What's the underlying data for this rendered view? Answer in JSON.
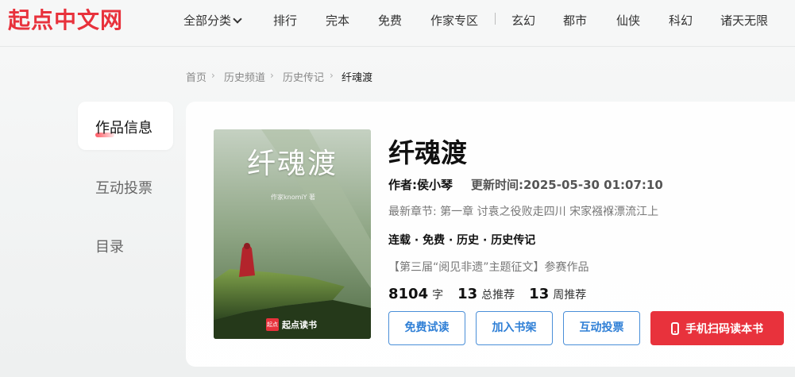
{
  "logo": "起点中文网",
  "nav": {
    "all_categories": "全部分类",
    "items": [
      "排行",
      "完本",
      "免费",
      "作家专区"
    ],
    "genres": [
      "玄幻",
      "都市",
      "仙侠",
      "科幻",
      "诸天无限"
    ]
  },
  "breadcrumb": [
    "首页",
    "历史频道",
    "历史传记",
    "纤魂渡"
  ],
  "side_tabs": [
    "作品信息",
    "互动投票",
    "目录"
  ],
  "cover": {
    "title": "纤魂渡",
    "author_line": "作家knomiY 著",
    "badge_icon": "起点",
    "badge_text": "起点读书"
  },
  "book": {
    "title": "纤魂渡",
    "author_label": "作者:",
    "author": "侯小琴",
    "update_label": "更新时间:",
    "update_time": "2025-05-30 01:07:10",
    "latest_label": "最新章节:",
    "latest_chapter": "第一章 讨袁之役败走四川 宋家襁褓漂流江上",
    "tags": [
      "连载",
      "免费",
      "历史",
      "历史传记"
    ],
    "event": "【第三届“阅见非遗”主题征文】参赛作品",
    "stats": [
      {
        "value": "8104",
        "unit": "字"
      },
      {
        "value": "13",
        "unit": "总推荐"
      },
      {
        "value": "13",
        "unit": "周推荐"
      }
    ]
  },
  "buttons": {
    "free_read": "免费试读",
    "add_shelf": "加入书架",
    "vote": "互动投票",
    "scan": "手机扫码读本书"
  },
  "colors": {
    "brand_red": "#e8323c",
    "link_blue": "#2f7fd6"
  }
}
